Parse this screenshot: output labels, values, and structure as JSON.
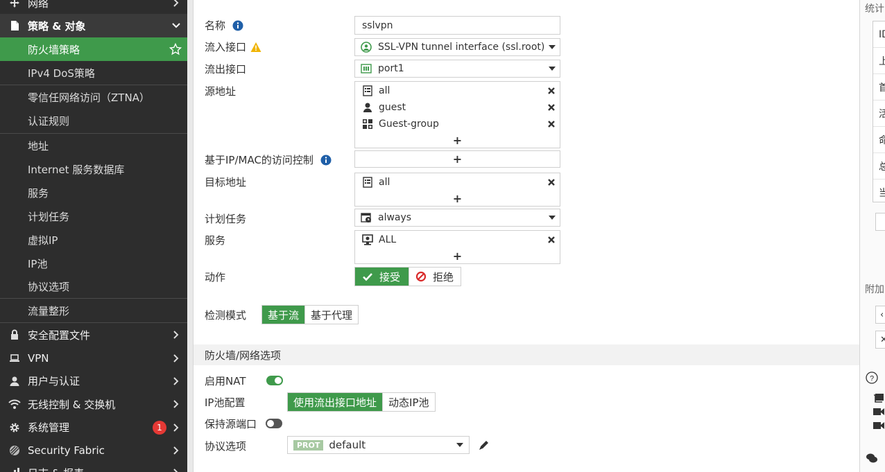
{
  "sidebar": {
    "items": [
      {
        "label": "网络",
        "icon": "network-icon",
        "level": "top",
        "chevron": "right"
      },
      {
        "label": "策略 & 对象",
        "icon": "policy-objects-icon",
        "level": "section",
        "chevron": "down"
      },
      {
        "label": "防火墙策略",
        "level": "sub",
        "active": true
      },
      {
        "label": "IPv4 DoS策略",
        "level": "sub"
      },
      {
        "label": "零信任网络访问（ZTNA）",
        "level": "sub"
      },
      {
        "label": "认证规则",
        "level": "sub"
      },
      {
        "label": "地址",
        "level": "sub"
      },
      {
        "label": "Internet 服务数据库",
        "level": "sub"
      },
      {
        "label": "服务",
        "level": "sub"
      },
      {
        "label": "计划任务",
        "level": "sub"
      },
      {
        "label": "虚拟IP",
        "level": "sub"
      },
      {
        "label": "IP池",
        "level": "sub"
      },
      {
        "label": "协议选项",
        "level": "sub"
      },
      {
        "label": "流量整形",
        "level": "sub"
      },
      {
        "label": "安全配置文件",
        "icon": "lock-icon",
        "level": "top",
        "chevron": "right"
      },
      {
        "label": "VPN",
        "icon": "laptop-icon",
        "level": "top",
        "chevron": "right"
      },
      {
        "label": "用户与认证",
        "icon": "user-icon",
        "level": "top",
        "chevron": "right"
      },
      {
        "label": "无线控制 & 交换机",
        "icon": "wifi-icon",
        "level": "top",
        "chevron": "right"
      },
      {
        "label": "系统管理",
        "icon": "gear-icon",
        "level": "top",
        "chevron": "right",
        "badge": "1"
      },
      {
        "label": "Security Fabric",
        "icon": "fabric-icon",
        "level": "top",
        "chevron": "right"
      },
      {
        "label": "日志 & 报表",
        "icon": "chart-icon",
        "level": "top",
        "chevron": "right"
      }
    ]
  },
  "form": {
    "name_label": "名称",
    "name_value": "sslvpn",
    "incoming_label": "流入接口",
    "incoming_value": "SSL-VPN tunnel interface (ssl.root)",
    "outgoing_label": "流出接口",
    "outgoing_value": "port1",
    "source_label": "源地址",
    "source_items": [
      "all",
      "guest",
      "Guest-group"
    ],
    "plus": "+",
    "ipmac_label": "基于IP/MAC的访问控制",
    "dest_label": "目标地址",
    "dest_items": [
      "all"
    ],
    "schedule_label": "计划任务",
    "schedule_value": "always",
    "service_label": "服务",
    "service_items": [
      "ALL"
    ],
    "action_label": "动作",
    "action_accept": "接受",
    "action_deny": "拒绝",
    "inspect_label": "检测模式",
    "inspect_flow": "基于流",
    "inspect_proxy": "基于代理"
  },
  "section": {
    "title": "防火墙/网络选项",
    "nat_label": "启用NAT",
    "nat_enabled": true,
    "ippool_label": "IP池配置",
    "ippool_outgoing": "使用流出接口地址",
    "ippool_dynamic": "动态IP池",
    "preserve_label": "保持源端口",
    "preserve_enabled": false,
    "protocol_label": "协议选项",
    "protocol_tag": "PROT",
    "protocol_value": "default"
  },
  "right_panel": {
    "stats_label": "统计",
    "stats_rows": [
      "ID",
      "上",
      "首",
      "活",
      "命",
      "总",
      "当"
    ],
    "extra_label": "附加",
    "btn1": "‹",
    "btn2": "✕",
    "help_icon": "?"
  },
  "colors": {
    "accent_green": "#3f9a4b",
    "sidebar_bg": "#2d2d2d",
    "badge_red": "#e53935",
    "info_blue": "#1f5fa8",
    "warn_yellow": "#f0b400"
  }
}
